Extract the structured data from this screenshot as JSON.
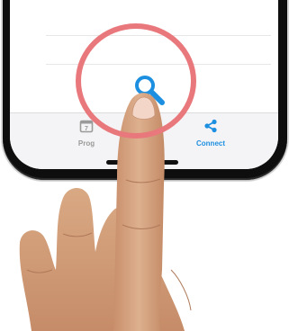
{
  "tabbar": {
    "items": [
      {
        "label": "Prog",
        "icon": "calendar-icon"
      },
      {
        "label": "Connect",
        "icon": "share-icon"
      }
    ]
  },
  "search": {
    "icon": "search-icon"
  },
  "colors": {
    "accent": "#1d8fe0",
    "highlight": "#e9787c",
    "inactive": "#9a9a9a"
  }
}
